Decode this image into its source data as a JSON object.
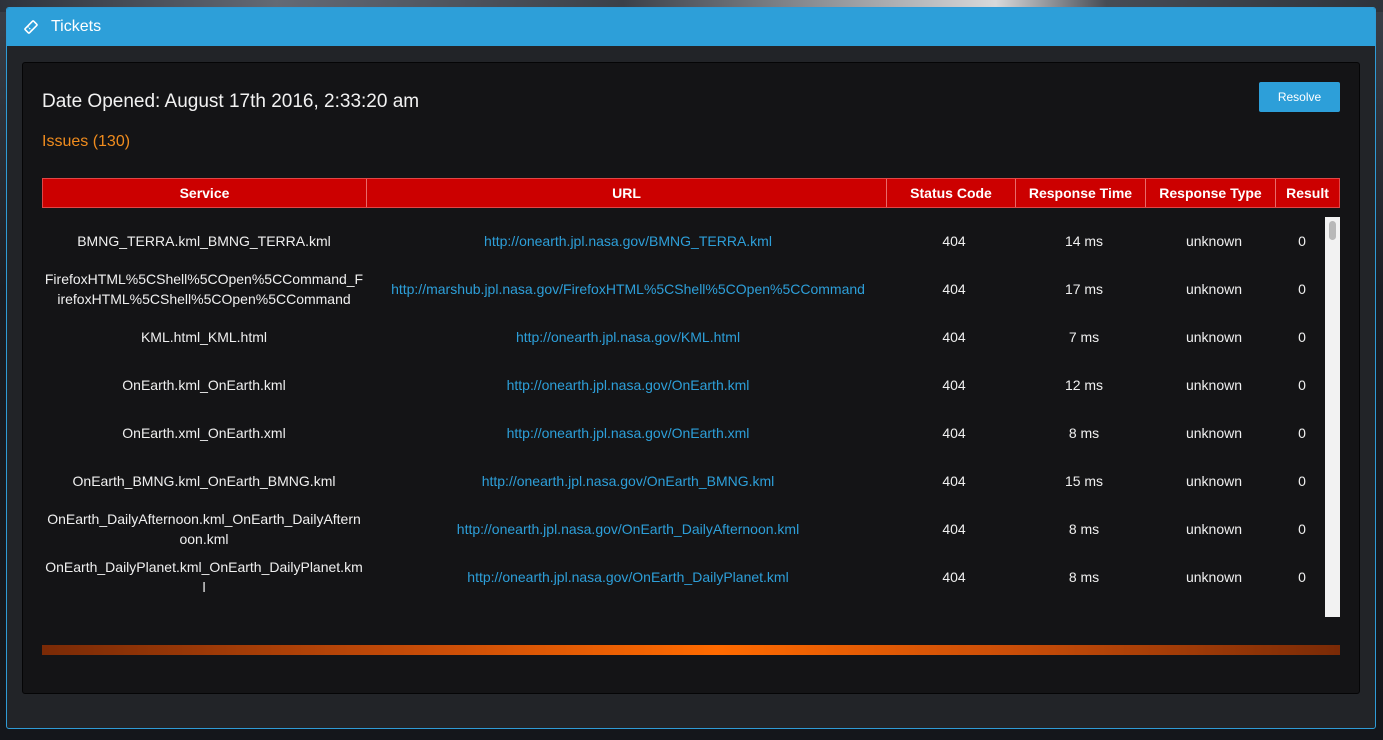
{
  "window": {
    "title": "Tickets",
    "icon": "ticket-icon",
    "accent_color": "#2d9fd9"
  },
  "ticket": {
    "date_opened": "Date Opened: August 17th 2016, 2:33:20 am",
    "issues_label": "Issues (130)",
    "resolve_label": "Resolve"
  },
  "table": {
    "header_color": "#cc0000",
    "columns": [
      "Service",
      "URL",
      "Status Code",
      "Response Time",
      "Response Type",
      "Result"
    ],
    "rows": [
      {
        "service": "BMNG_TERRA.kml_BMNG_TERRA.kml",
        "url": "http://onearth.jpl.nasa.gov/BMNG_TERRA.kml",
        "status": "404",
        "time": "14 ms",
        "type": "unknown",
        "result": "0"
      },
      {
        "service": "FirefoxHTML%5CShell%5COpen%5CCommand_FirefoxHTML%5CShell%5COpen%5CCommand",
        "url": "http://marshub.jpl.nasa.gov/FirefoxHTML%5CShell%5COpen%5CCommand",
        "status": "404",
        "time": "17 ms",
        "type": "unknown",
        "result": "0"
      },
      {
        "service": "KML.html_KML.html",
        "url": "http://onearth.jpl.nasa.gov/KML.html",
        "status": "404",
        "time": "7 ms",
        "type": "unknown",
        "result": "0"
      },
      {
        "service": "OnEarth.kml_OnEarth.kml",
        "url": "http://onearth.jpl.nasa.gov/OnEarth.kml",
        "status": "404",
        "time": "12 ms",
        "type": "unknown",
        "result": "0"
      },
      {
        "service": "OnEarth.xml_OnEarth.xml",
        "url": "http://onearth.jpl.nasa.gov/OnEarth.xml",
        "status": "404",
        "time": "8 ms",
        "type": "unknown",
        "result": "0"
      },
      {
        "service": "OnEarth_BMNG.kml_OnEarth_BMNG.kml",
        "url": "http://onearth.jpl.nasa.gov/OnEarth_BMNG.kml",
        "status": "404",
        "time": "15 ms",
        "type": "unknown",
        "result": "0"
      },
      {
        "service": "OnEarth_DailyAfternoon.kml_OnEarth_DailyAfternoon.kml",
        "url": "http://onearth.jpl.nasa.gov/OnEarth_DailyAfternoon.kml",
        "status": "404",
        "time": "8 ms",
        "type": "unknown",
        "result": "0"
      },
      {
        "service": "OnEarth_DailyPlanet.kml_OnEarth_DailyPlanet.kml",
        "url": "http://onearth.jpl.nasa.gov/OnEarth_DailyPlanet.kml",
        "status": "404",
        "time": "8 ms",
        "type": "unknown",
        "result": "0"
      }
    ]
  },
  "progress": {
    "color": "#ff6a00"
  }
}
